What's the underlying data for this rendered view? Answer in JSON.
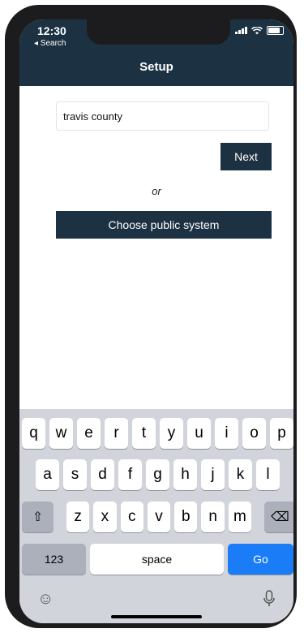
{
  "status_bar": {
    "time": "12:30",
    "back_label": "◂ Search"
  },
  "nav": {
    "title": "Setup"
  },
  "form": {
    "search_value": "travis county",
    "search_placeholder": "",
    "next_label": "Next",
    "or_label": "or",
    "public_label": "Choose public system"
  },
  "keyboard": {
    "row1": [
      "q",
      "w",
      "e",
      "r",
      "t",
      "y",
      "u",
      "i",
      "o",
      "p"
    ],
    "row2": [
      "a",
      "s",
      "d",
      "f",
      "g",
      "h",
      "j",
      "k",
      "l"
    ],
    "row3": [
      "z",
      "x",
      "c",
      "v",
      "b",
      "n",
      "m"
    ],
    "numbers_label": "123",
    "space_label": "space",
    "go_label": "Go",
    "shift_icon": "⇧",
    "delete_icon": "⌫",
    "emoji_icon": "☺",
    "mic_icon": "🎙"
  },
  "colors": {
    "nav_bg": "#1c3142",
    "go_key": "#1a7cf6",
    "keyboard_bg": "#d1d4db"
  }
}
